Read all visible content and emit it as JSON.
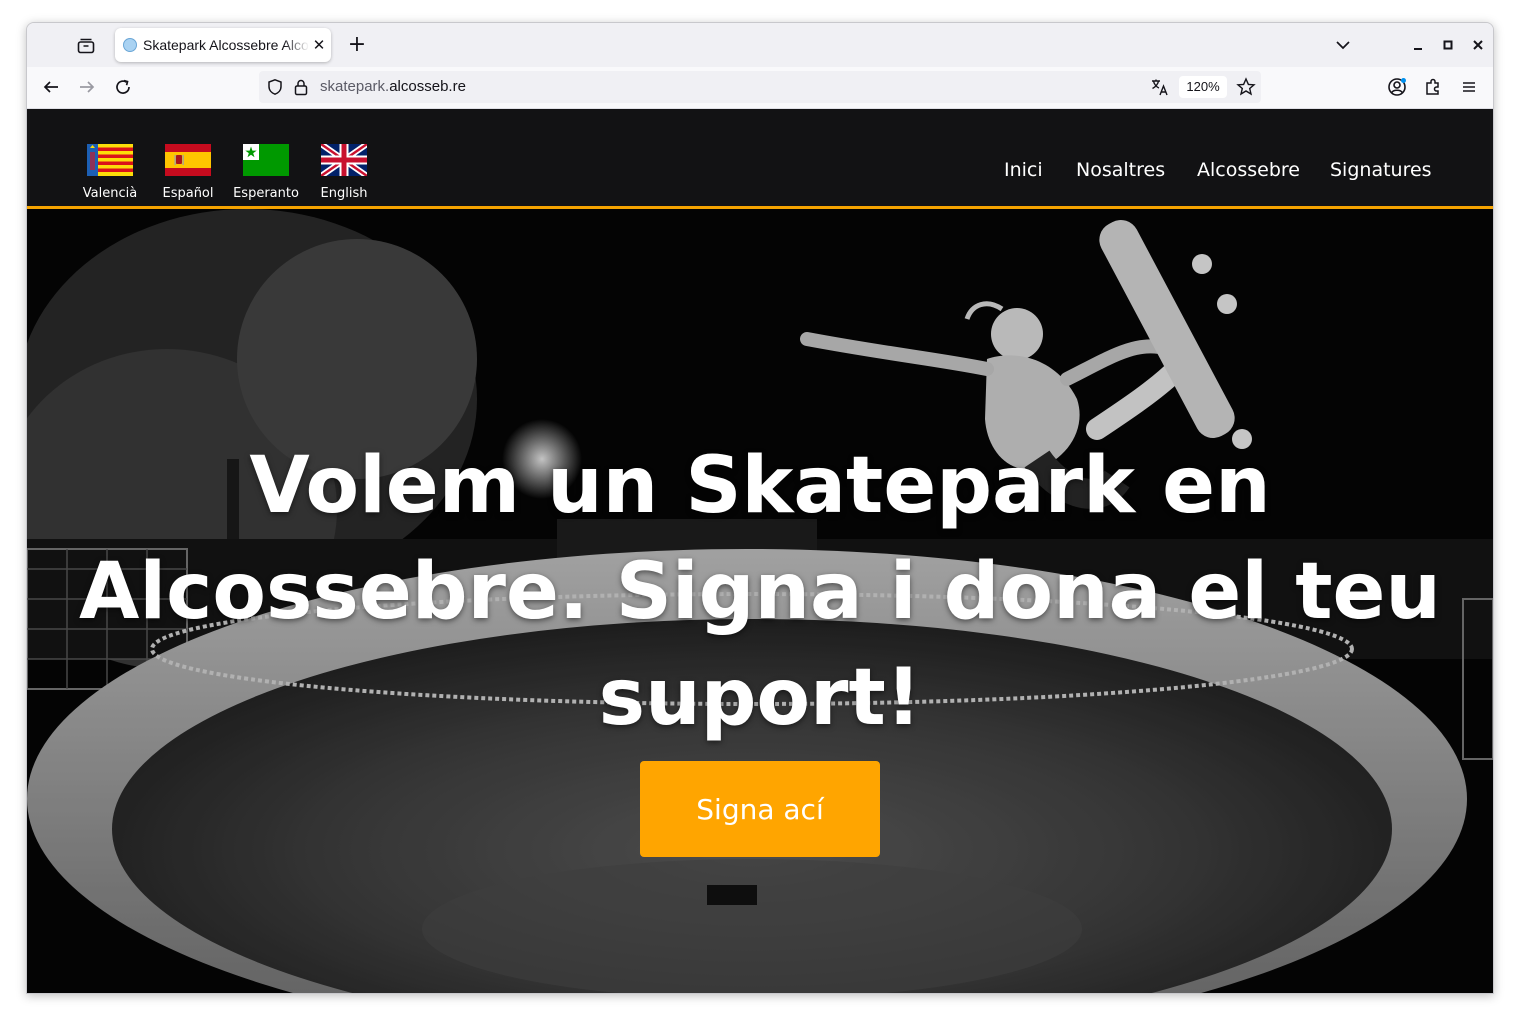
{
  "browser": {
    "tab": {
      "title": "Skatepark Alcossebre Alcossebre",
      "favicon": "globe-icon"
    },
    "url": {
      "scheme_part": "skatepark.",
      "host_part": "alcosseb.re"
    },
    "zoom": "120%"
  },
  "site": {
    "languages": [
      {
        "label": "Valencià"
      },
      {
        "label": "Español"
      },
      {
        "label": "Esperanto"
      },
      {
        "label": "English"
      }
    ],
    "menu": [
      "Inici",
      "Nosaltres",
      "Alcossebre",
      "Signatures"
    ],
    "hero": {
      "title": "Volem un Skatepark en Alcossebre. Signa i dona el teu suport!",
      "cta_label": "Signa ací"
    }
  },
  "colors": {
    "accent": "#ffa500",
    "header_bg": "#121214",
    "header_border": "#f5a300"
  }
}
